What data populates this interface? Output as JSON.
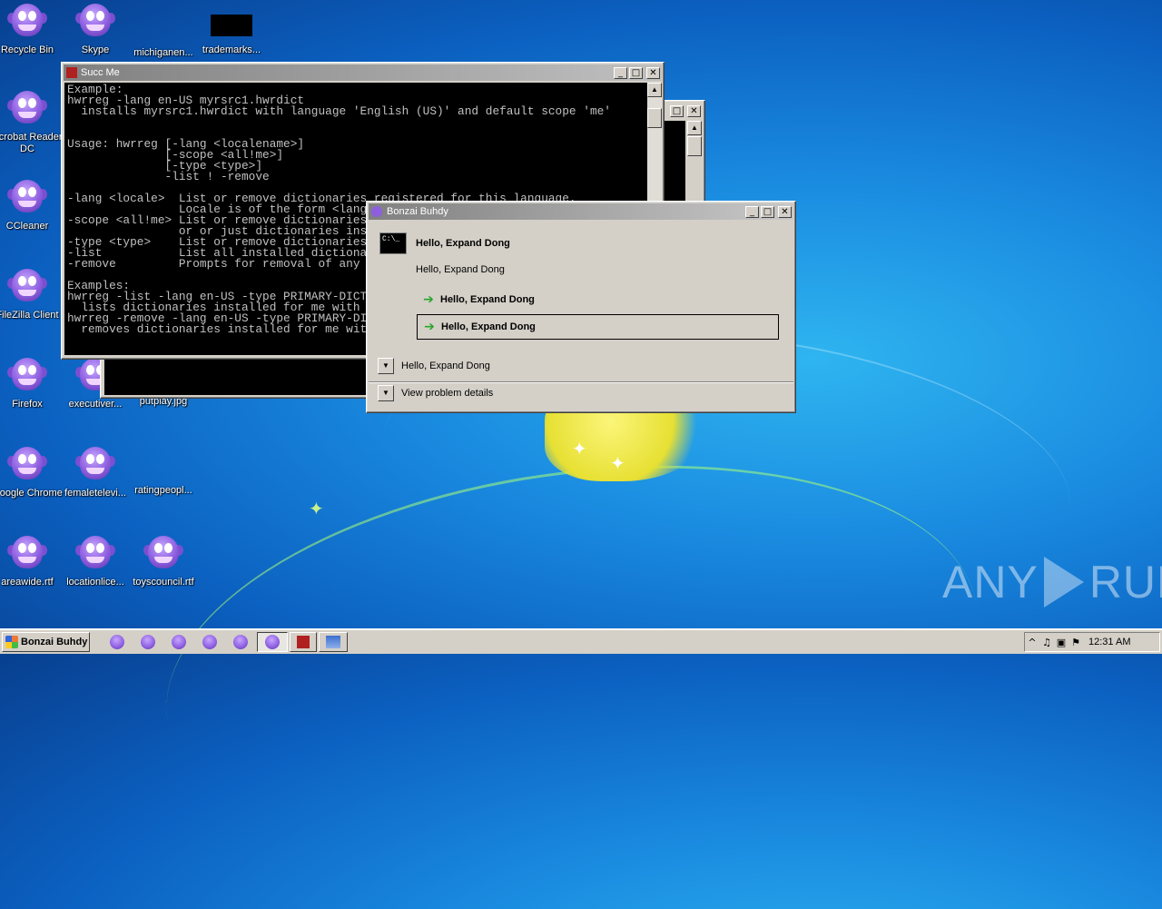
{
  "desktop": {
    "icons": [
      {
        "label": "Recycle Bin",
        "kind": "bonzi"
      },
      {
        "label": "Skype",
        "kind": "bonzi"
      },
      {
        "label": "michiganen...",
        "kind": "blank"
      },
      {
        "label": "trademarks...",
        "kind": "black-thumb"
      },
      {
        "label": "Acrobat Reader DC",
        "kind": "bonzi"
      },
      {
        "label": "CCleaner",
        "kind": "bonzi"
      },
      {
        "label": "FileZilla Client",
        "kind": "bonzi"
      },
      {
        "label": "Firefox",
        "kind": "bonzi"
      },
      {
        "label": "executiver...",
        "kind": "bonzi"
      },
      {
        "label": "putplay.jpg",
        "kind": "image"
      },
      {
        "label": "Google Chrome",
        "kind": "bonzi"
      },
      {
        "label": "femaletelevi...",
        "kind": "bonzi"
      },
      {
        "label": "ratingpeopl...",
        "kind": "image"
      },
      {
        "label": "areawide.rtf",
        "kind": "bonzi"
      },
      {
        "label": "locationlice...",
        "kind": "bonzi"
      },
      {
        "label": "toyscouncil.rtf",
        "kind": "bonzi"
      }
    ]
  },
  "console_window": {
    "title": "Succ Me",
    "lines": [
      "Example:",
      "hwrreg -lang en-US myrsrc1.hwrdict",
      "  installs myrsrc1.hwrdict with language 'English (US)' and default scope 'me'",
      "",
      "",
      "Usage: hwrreg [-lang <localename>]",
      "              [-scope <all!me>]",
      "              [-type <type>]",
      "              -list ! -remove",
      "",
      "-lang <locale>  List or remove dictionaries registered for this language.",
      "                Locale is of the form <language>-<REGION>",
      "-scope <all!me> List or remove dictionaries registered for all users",
      "                or or just dictionaries installed for me.",
      "-type <type>    List or remove dictionaries of a certain type.",
      "-list           List all installed dictionaries",
      "-remove         Prompts for removal of any dictionaries.",
      "",
      "Examples:",
      "hwrreg -list -lang en-US -type PRIMARY-DICTIONARY",
      "  lists dictionaries installed for me with language en-US",
      "hwrreg -remove -lang en-US -type PRIMARY-DICTIONARY",
      "  removes dictionaries installed for me with language en-US"
    ]
  },
  "dialog": {
    "title": "Bonzai Buhdy",
    "heading": "Hello, Expand Dong",
    "message": "Hello, Expand Dong",
    "command_links": [
      {
        "label": "Hello, Expand Dong"
      },
      {
        "label": "Hello, Expand Dong"
      }
    ],
    "expander_label": "Hello, Expand Dong",
    "details_label": "View problem details"
  },
  "taskbar": {
    "start_label": "Bonzai Buhdy",
    "clock": "12:31 AM"
  },
  "watermark": {
    "left": "ANY",
    "right": "RUN"
  }
}
